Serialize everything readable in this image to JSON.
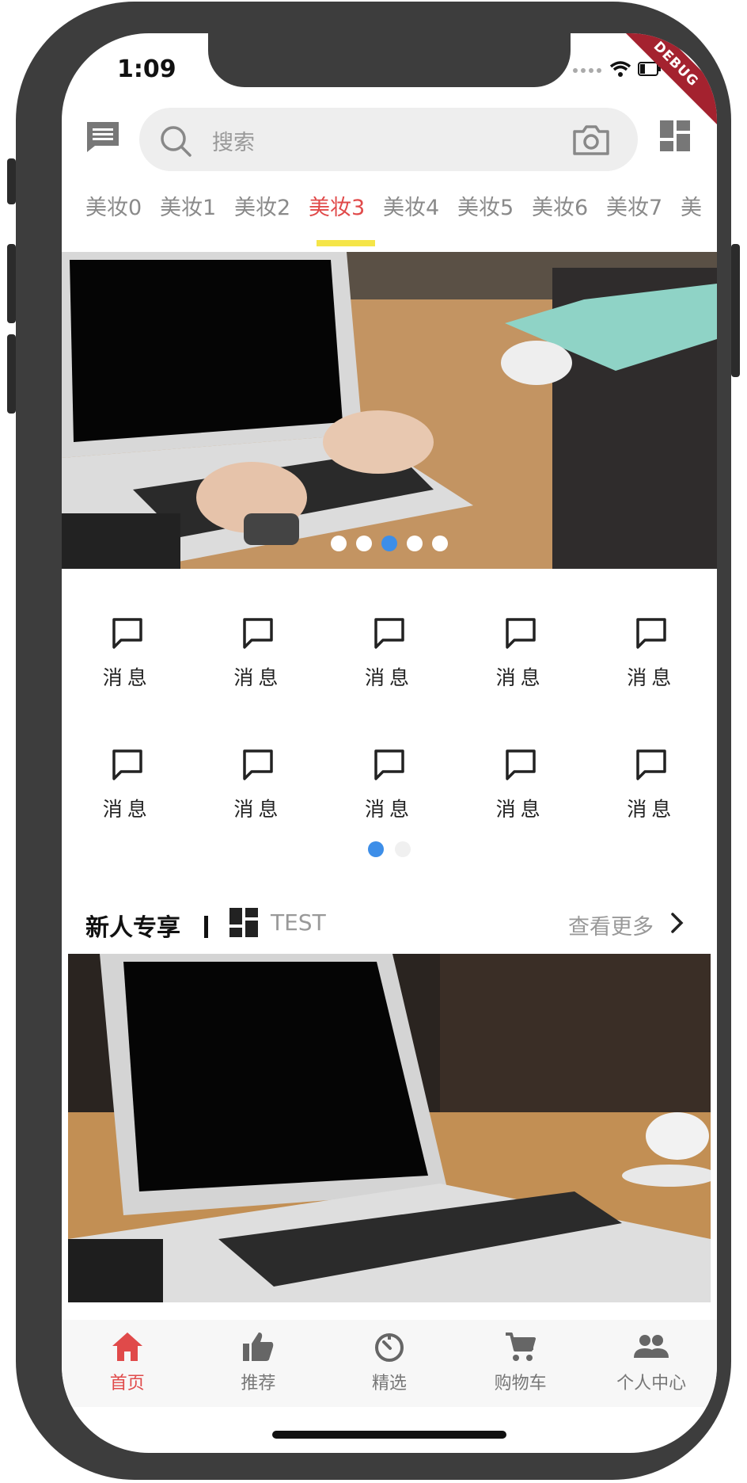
{
  "status_bar": {
    "time": "1:09",
    "debug_label": "DEBUG"
  },
  "search": {
    "placeholder": "搜索"
  },
  "category_tabs": [
    {
      "label": "美妆0",
      "active": false
    },
    {
      "label": "美妆1",
      "active": false
    },
    {
      "label": "美妆2",
      "active": false
    },
    {
      "label": "美妆3",
      "active": true
    },
    {
      "label": "美妆4",
      "active": false
    },
    {
      "label": "美妆5",
      "active": false
    },
    {
      "label": "美妆6",
      "active": false
    },
    {
      "label": "美妆7",
      "active": false
    },
    {
      "label": "美",
      "active": false
    }
  ],
  "banner": {
    "dot_count": 5,
    "active_dot": 2
  },
  "grid": {
    "items": [
      {
        "label": "消息",
        "icon": "chat-bubble-icon"
      },
      {
        "label": "消息",
        "icon": "chat-bubble-icon"
      },
      {
        "label": "消息",
        "icon": "chat-bubble-icon"
      },
      {
        "label": "消息",
        "icon": "chat-bubble-icon"
      },
      {
        "label": "消息",
        "icon": "chat-bubble-icon"
      },
      {
        "label": "消息",
        "icon": "chat-bubble-icon"
      },
      {
        "label": "消息",
        "icon": "chat-bubble-icon"
      },
      {
        "label": "消息",
        "icon": "chat-bubble-icon"
      },
      {
        "label": "消息",
        "icon": "chat-bubble-icon"
      },
      {
        "label": "消息",
        "icon": "chat-bubble-icon"
      }
    ],
    "page_count": 2,
    "active_page": 0
  },
  "section": {
    "title": "新人专享",
    "subtitle": "TEST",
    "more_label": "查看更多"
  },
  "tabbar": [
    {
      "label": "首页",
      "icon": "home-icon",
      "active": true
    },
    {
      "label": "推荐",
      "icon": "thumb-up-icon",
      "active": false
    },
    {
      "label": "精选",
      "icon": "timer-icon",
      "active": false
    },
    {
      "label": "购物车",
      "icon": "cart-icon",
      "active": false
    },
    {
      "label": "个人中心",
      "icon": "people-icon",
      "active": false
    }
  ],
  "colors": {
    "accent": "#e04a4a",
    "indicator": "#f5e548",
    "dot_active": "#3d8ee8"
  }
}
